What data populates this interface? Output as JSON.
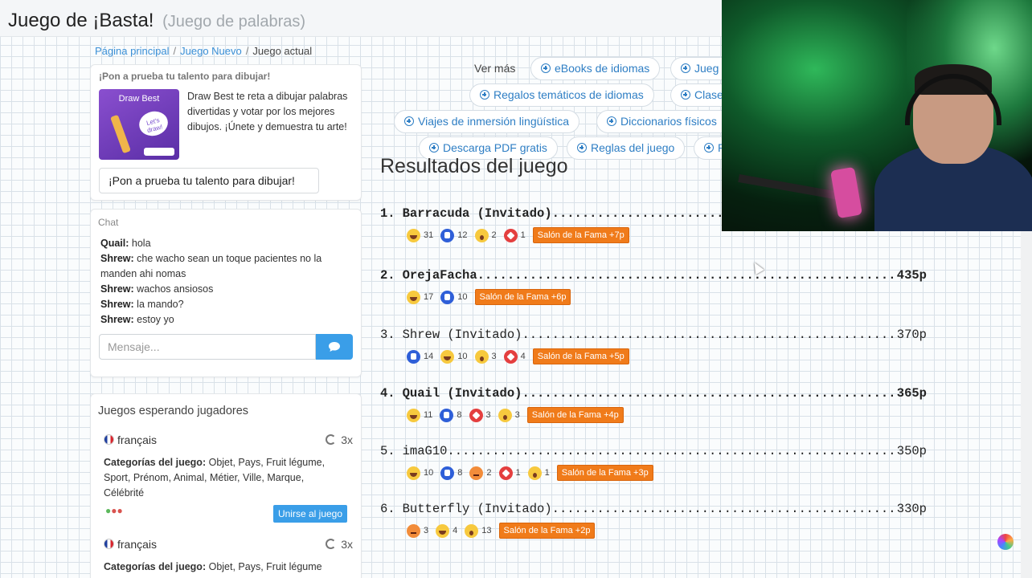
{
  "header": {
    "title": "Juego de ¡Basta!",
    "subtitle": "(Juego de palabras)"
  },
  "breadcrumb": {
    "home": "Página principal",
    "new_game": "Juego Nuevo",
    "current": "Juego actual"
  },
  "promo": {
    "heading": "¡Pon a prueba tu talento para dibujar!",
    "image_title": "Draw Best",
    "image_bubble": "Let's draw!",
    "text": "Draw Best te reta a dibujar palabras divertidas y votar por los mejores dibujos. ¡Únete y demuestra tu arte!",
    "button": "¡Pon a prueba tu talento para dibujar!"
  },
  "chat": {
    "heading": "Chat",
    "messages": [
      {
        "user": "Quail:",
        "text": "hola"
      },
      {
        "user": "Shrew:",
        "text": "che wacho sean un toque pacientes no la manden ahi nomas"
      },
      {
        "user": "Shrew:",
        "text": "wachos ansiosos"
      },
      {
        "user": "Shrew:",
        "text": "la mando?"
      },
      {
        "user": "Shrew:",
        "text": "estoy yo"
      }
    ],
    "placeholder": "Mensaje..."
  },
  "waiting": {
    "heading": "Juegos esperando jugadores",
    "games": [
      {
        "lang": "français",
        "rounds": "3x",
        "cats_label": "Categorías del juego:",
        "cats": "Objet, Pays, Fruit légume, Sport, Prénom, Animal, Métier, Ville, Marque, Célébrité",
        "join": "Unirse al juego"
      },
      {
        "lang": "français",
        "rounds": "3x",
        "cats_label": "Categorías del juego:",
        "cats": "Objet, Pays, Fruit légume"
      }
    ]
  },
  "links": {
    "more": "Ver más",
    "items": [
      "eBooks de idiomas",
      "Jueg",
      "Regalos temáticos de idiomas",
      "Clase",
      "Viajes de inmersión lingüística",
      "Diccionarios físicos",
      "Descarga PDF gratis",
      "Reglas del juego",
      "P"
    ]
  },
  "results": {
    "title": "Resultados del juego",
    "rows": [
      {
        "rank": "1.",
        "name": "Barracuda (Invitado)",
        "points": "",
        "bold": true,
        "reacts": [
          {
            "type": "laugh",
            "n": "31"
          },
          {
            "type": "like",
            "n": "12"
          },
          {
            "type": "wow",
            "n": "2"
          },
          {
            "type": "heart",
            "n": "1"
          }
        ],
        "fame": "Salón de la Fama +7p"
      },
      {
        "rank": "2.",
        "name": "OrejaFacha",
        "points": "435p",
        "bold": true,
        "reacts": [
          {
            "type": "laugh",
            "n": "17"
          },
          {
            "type": "like",
            "n": "10"
          }
        ],
        "fame": "Salón de la Fama +6p"
      },
      {
        "rank": "3.",
        "name": "Shrew (Invitado)",
        "points": "370p",
        "bold": false,
        "reacts": [
          {
            "type": "like",
            "n": "14"
          },
          {
            "type": "laugh",
            "n": "10"
          },
          {
            "type": "wow",
            "n": "3"
          },
          {
            "type": "heart",
            "n": "4"
          }
        ],
        "fame": "Salón de la Fama +5p"
      },
      {
        "rank": "4.",
        "name": "Quail (Invitado)",
        "points": "365p",
        "bold": true,
        "reacts": [
          {
            "type": "laugh",
            "n": "11"
          },
          {
            "type": "like",
            "n": "8"
          },
          {
            "type": "heart",
            "n": "3"
          },
          {
            "type": "wow",
            "n": "3"
          }
        ],
        "fame": "Salón de la Fama +4p"
      },
      {
        "rank": "5.",
        "name": "imaG10",
        "points": "350p",
        "bold": false,
        "reacts": [
          {
            "type": "laugh",
            "n": "10"
          },
          {
            "type": "like",
            "n": "8"
          },
          {
            "type": "angry",
            "n": "2"
          },
          {
            "type": "heart",
            "n": "1"
          },
          {
            "type": "wow",
            "n": "1"
          }
        ],
        "fame": "Salón de la Fama +3p"
      },
      {
        "rank": "6.",
        "name": "Butterfly (Invitado)",
        "points": "330p",
        "bold": false,
        "reacts": [
          {
            "type": "angry",
            "n": "3"
          },
          {
            "type": "laugh",
            "n": "4"
          },
          {
            "type": "wow",
            "n": "13"
          }
        ],
        "fame": "Salón de la Fama +2p"
      }
    ]
  },
  "colors": {
    "accent": "#3a9ee8",
    "fame": "#f07b1a",
    "link": "#2e7ec4"
  }
}
